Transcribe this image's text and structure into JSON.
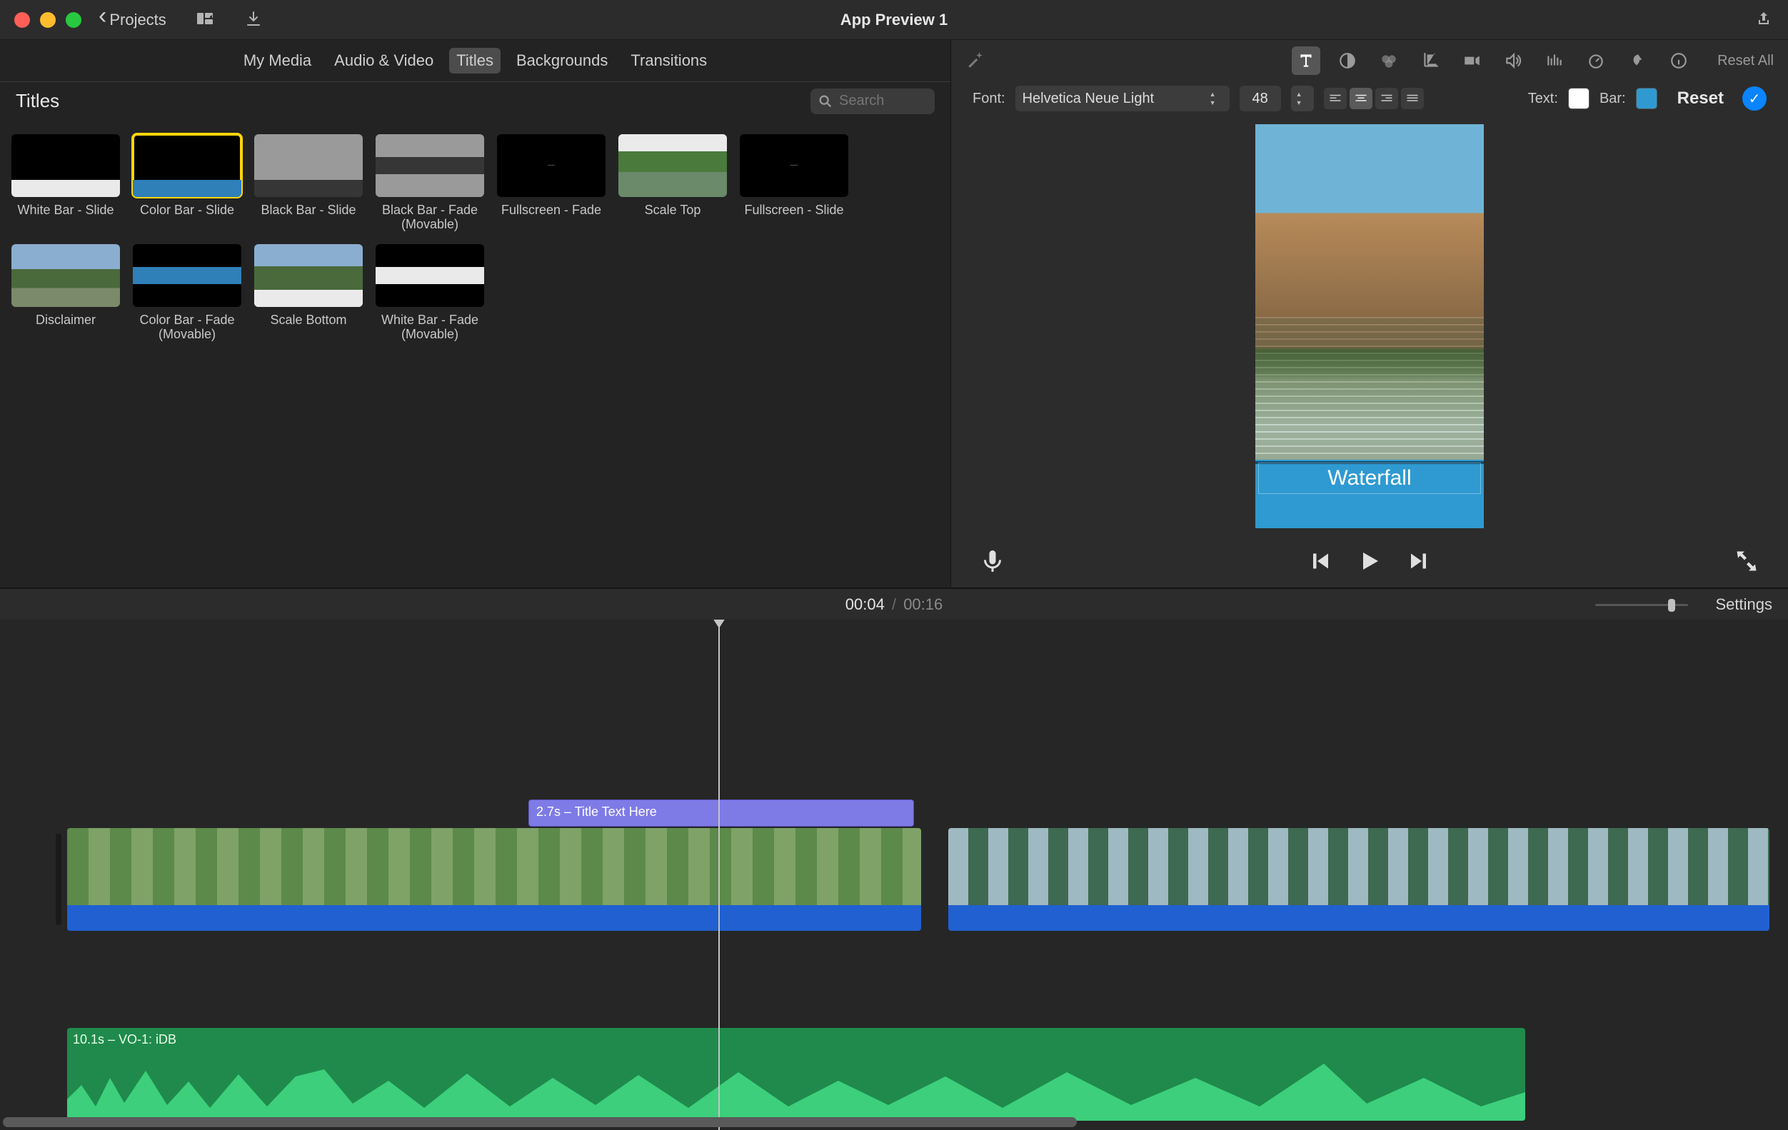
{
  "toolbar": {
    "back_label": "Projects",
    "title": "App Preview 1"
  },
  "tabs": {
    "my_media": "My Media",
    "audio_video": "Audio & Video",
    "titles": "Titles",
    "backgrounds": "Backgrounds",
    "transitions": "Transitions"
  },
  "titles_header": {
    "label": "Titles",
    "search_placeholder": "Search"
  },
  "tiles": {
    "t0": "White Bar - Slide",
    "t1": "Color Bar - Slide",
    "t2": "Black Bar - Slide",
    "t3": "Black Bar - Fade (Movable)",
    "t4": "Fullscreen - Fade",
    "t5": "Scale Top",
    "t6": "Fullscreen - Slide",
    "t7": "Disclaimer",
    "t8": "Color Bar - Fade (Movable)",
    "t9": "Scale Bottom",
    "t10": "White Bar - Fade (Movable)"
  },
  "inspector": {
    "reset_all": "Reset All",
    "font_label": "Font:",
    "font_value": "Helvetica Neue Light",
    "size_value": "48",
    "text_label": "Text:",
    "bar_label": "Bar:",
    "text_color": "#ffffff",
    "bar_color": "#2f9ad1",
    "reset": "Reset"
  },
  "preview": {
    "title_text": "Waterfall"
  },
  "timebar": {
    "current": "00:04",
    "separator": "/",
    "total": "00:16",
    "settings": "Settings"
  },
  "timeline": {
    "title_clip": "2.7s – Title Text Here",
    "vo_label": "10.1s – VO-1: iDB"
  }
}
